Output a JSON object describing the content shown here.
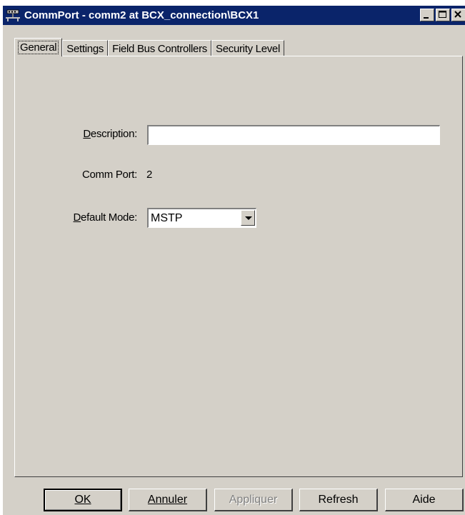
{
  "window": {
    "title": "CommPort - comm2 at BCX_connection\\BCX1"
  },
  "tabs": [
    "General",
    "Settings",
    "Field Bus Controllers",
    "Security Level"
  ],
  "general": {
    "description_label": "Description:",
    "description_value": "",
    "comm_port_label": "Comm Port:",
    "comm_port_value": "2",
    "default_mode_label": "Default Mode:",
    "default_mode_value": "MSTP"
  },
  "buttons": {
    "ok": "OK",
    "cancel": "Annuler",
    "apply": "Appliquer",
    "refresh": "Refresh",
    "help": "Aide"
  },
  "icons": {
    "app": "network-icon",
    "minimize": "minimize-icon",
    "maximize": "maximize-icon",
    "close": "close-icon",
    "dropdown": "chevron-down-icon"
  },
  "colors": {
    "titlebar": "#0a246a",
    "face": "#d4d0c8"
  }
}
